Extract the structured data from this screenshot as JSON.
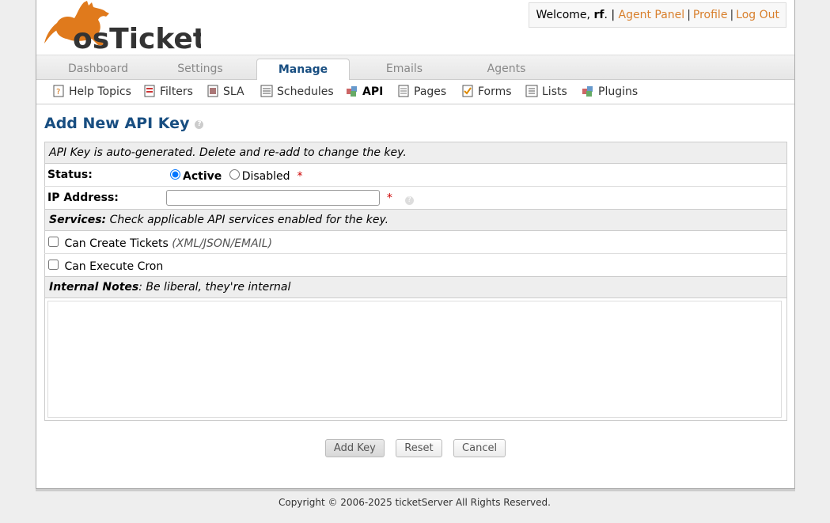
{
  "header": {
    "logo_text": "osTicket",
    "welcome_prefix": "Welcome, ",
    "username": "rf",
    "welcome_suffix": ". |",
    "agent_panel": "Agent Panel",
    "profile": "Profile",
    "logout": "Log Out"
  },
  "nav": {
    "tabs": [
      {
        "label": "Dashboard"
      },
      {
        "label": "Settings"
      },
      {
        "label": "Manage"
      },
      {
        "label": "Emails"
      },
      {
        "label": "Agents"
      }
    ],
    "active_tab": "Manage"
  },
  "subnav": {
    "items": [
      {
        "label": "Help Topics",
        "icon": "help-topics-icon"
      },
      {
        "label": "Filters",
        "icon": "filters-icon"
      },
      {
        "label": "SLA",
        "icon": "sla-icon"
      },
      {
        "label": "Schedules",
        "icon": "schedules-icon"
      },
      {
        "label": "API",
        "icon": "api-icon"
      },
      {
        "label": "Pages",
        "icon": "pages-icon"
      },
      {
        "label": "Forms",
        "icon": "forms-icon"
      },
      {
        "label": "Lists",
        "icon": "lists-icon"
      },
      {
        "label": "Plugins",
        "icon": "plugins-icon"
      }
    ],
    "active_item": "API"
  },
  "page": {
    "title": "Add New API Key",
    "note": "API Key is auto-generated. Delete and re-add to change the key.",
    "status_label": "Status:",
    "status_active": "Active",
    "status_disabled": "Disabled",
    "status_selected": "Active",
    "ip_label": "IP Address:",
    "ip_value": "",
    "required_mark": "*",
    "services_heading": "Services:",
    "services_note": " Check applicable API services enabled for the key.",
    "service_create_tickets": "Can Create Tickets",
    "service_create_tickets_note": "(XML/JSON/EMAIL)",
    "service_execute_cron": "Can Execute Cron",
    "notes_heading": "Internal Notes",
    "notes_note": ": Be liberal, they're internal",
    "notes_value": ""
  },
  "buttons": {
    "add": "Add Key",
    "reset": "Reset",
    "cancel": "Cancel"
  },
  "footer": {
    "copyright": "Copyright © 2006-2025 ticketServer All Rights Reserved."
  },
  "colors": {
    "brand_orange": "#d87f2c",
    "title_blue": "#184e81"
  }
}
